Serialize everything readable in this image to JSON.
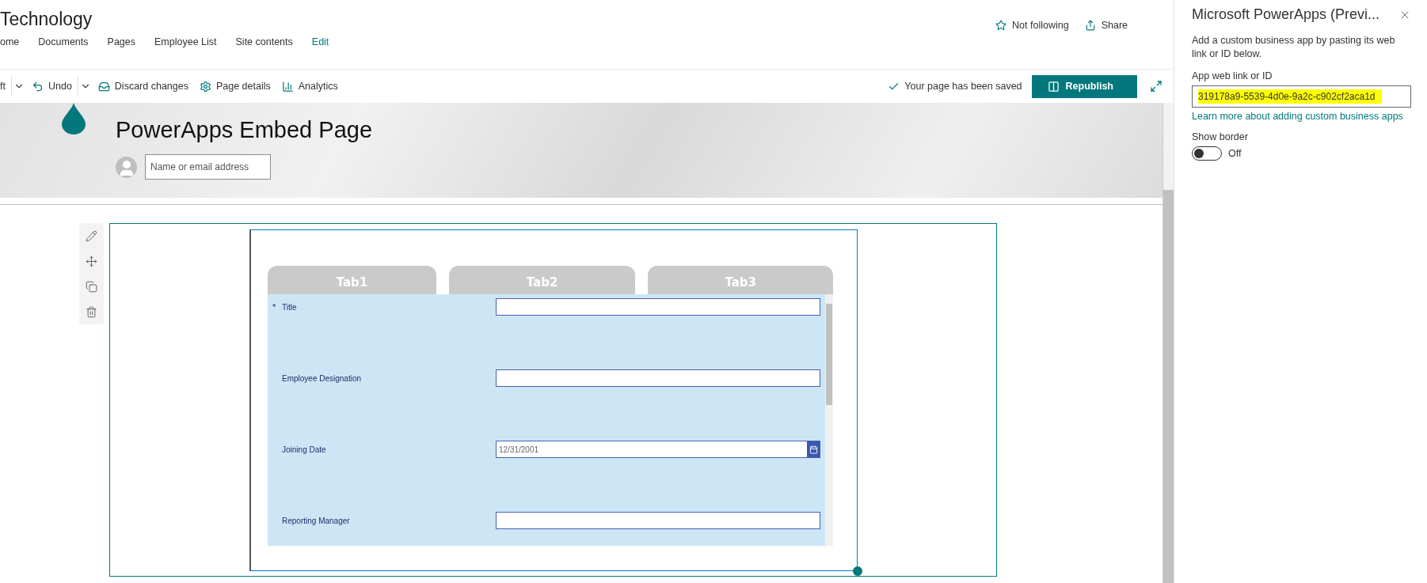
{
  "site": {
    "title": "Technology",
    "nav": [
      "ome",
      "Documents",
      "Pages",
      "Employee List",
      "Site contents"
    ],
    "edit_link": "Edit",
    "follow": "Not following",
    "share": "Share"
  },
  "toolbar": {
    "draft": "ft",
    "undo": "Undo",
    "discard": "Discard changes",
    "page_details": "Page details",
    "analytics": "Analytics",
    "status": "Your page has been saved",
    "republish": "Republish"
  },
  "banner": {
    "title": "PowerApps Embed Page",
    "author_placeholder": "Name or email address"
  },
  "app": {
    "tabs": [
      "Tab1",
      "Tab2",
      "Tab3"
    ],
    "fields": [
      {
        "label": "Title",
        "required_mark": "*",
        "kind": "text"
      },
      {
        "label": "Employee Designation",
        "kind": "text"
      },
      {
        "label": "Joining Date",
        "kind": "date",
        "value": "12/31/2001"
      },
      {
        "label": "Reporting Manager",
        "kind": "text"
      }
    ]
  },
  "panel": {
    "title": "Microsoft PowerApps (Previ...",
    "description": "Add a custom business app by pasting its web link or ID below.",
    "field_label": "App web link or ID",
    "field_value": "319178a9-5539-4d0e-9a2c-c902cf2aca1d",
    "link": "Learn more about adding custom business apps",
    "toggle_label": "Show border",
    "toggle": {
      "on": false,
      "text": "Off"
    }
  }
}
